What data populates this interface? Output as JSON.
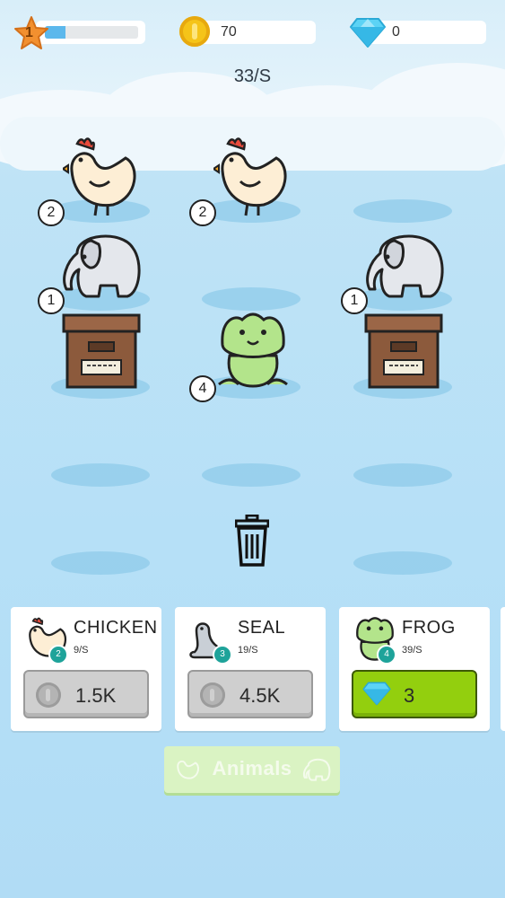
{
  "hud": {
    "level": "1",
    "xp_progress": 0.22,
    "coins": "70",
    "gems": "0",
    "income_rate": "33/S"
  },
  "field": {
    "slots": [
      {
        "row": 0,
        "col": 0,
        "animal": "chicken",
        "level": "2"
      },
      {
        "row": 0,
        "col": 1,
        "animal": "chicken",
        "level": "2"
      },
      {
        "row": 0,
        "col": 2,
        "animal": "empty",
        "level": ""
      },
      {
        "row": 1,
        "col": 0,
        "animal": "elephant",
        "level": "1"
      },
      {
        "row": 1,
        "col": 1,
        "animal": "empty",
        "level": ""
      },
      {
        "row": 1,
        "col": 2,
        "animal": "elephant",
        "level": "1"
      },
      {
        "row": 2,
        "col": 0,
        "animal": "crate",
        "level": ""
      },
      {
        "row": 2,
        "col": 1,
        "animal": "frog",
        "level": "4"
      },
      {
        "row": 2,
        "col": 2,
        "animal": "crate",
        "level": ""
      },
      {
        "row": 3,
        "col": 0,
        "animal": "empty",
        "level": ""
      },
      {
        "row": 3,
        "col": 1,
        "animal": "empty",
        "level": ""
      },
      {
        "row": 3,
        "col": 2,
        "animal": "empty",
        "level": ""
      },
      {
        "row": 4,
        "col": 0,
        "animal": "empty",
        "level": ""
      },
      {
        "row": 4,
        "col": 2,
        "animal": "empty",
        "level": ""
      }
    ]
  },
  "shop": {
    "cards": [
      {
        "name": "CHICKEN",
        "rate": "9/S",
        "level": "2",
        "price": "1.5K",
        "currency": "coin",
        "icon": "chicken-icon"
      },
      {
        "name": "SEAL",
        "rate": "19/S",
        "level": "3",
        "price": "4.5K",
        "currency": "coin",
        "icon": "seal-icon"
      },
      {
        "name": "FROG",
        "rate": "39/S",
        "level": "4",
        "price": "3",
        "currency": "gem",
        "icon": "frog-icon"
      }
    ]
  },
  "animals_button": {
    "label": "Animals"
  },
  "colors": {
    "sky": "#b6e0f7",
    "coin": "#f5c419",
    "gem": "#47c6ee",
    "buy_green": "#93cf0e",
    "badge_teal": "#1ea39a"
  }
}
